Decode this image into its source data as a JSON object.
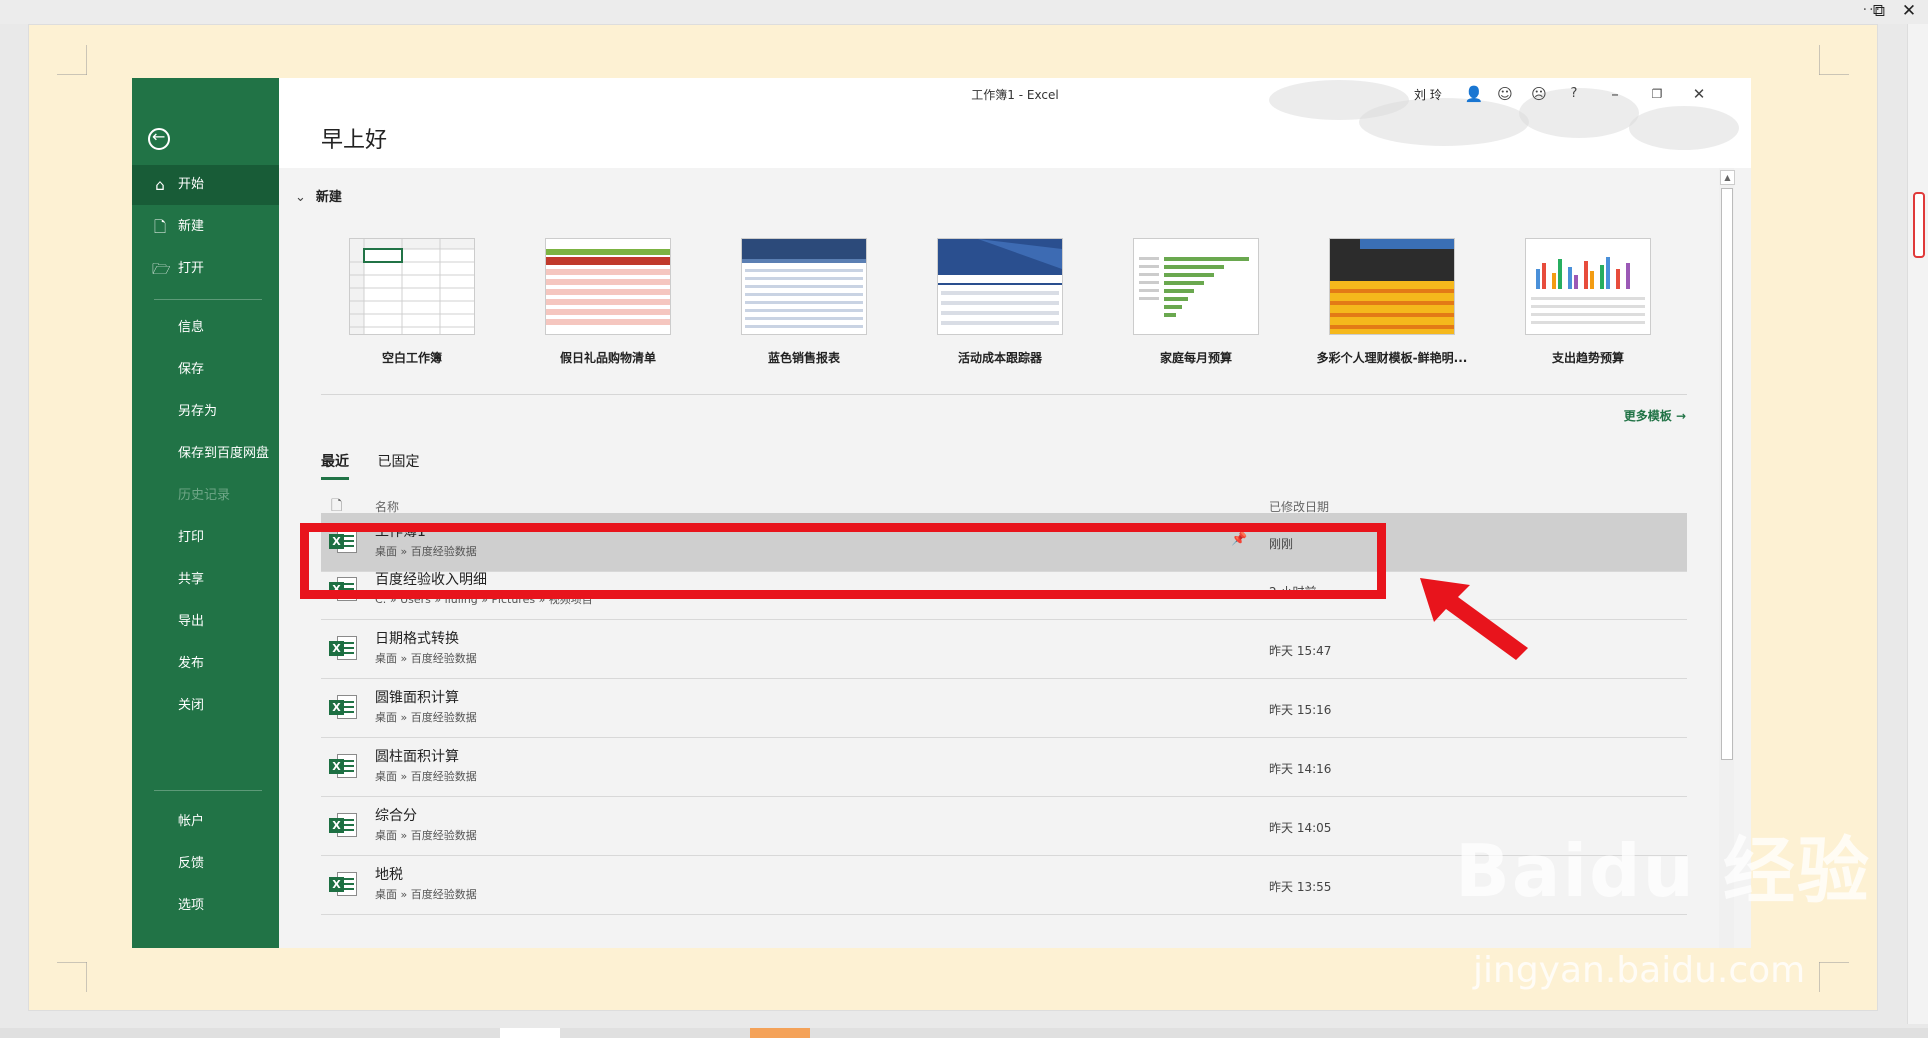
{
  "window": {
    "title": "工作簿1  -  Excel",
    "user": "刘 玲"
  },
  "outer": {
    "more": "···"
  },
  "sidebar": {
    "items": [
      {
        "label": "开始",
        "icon": "home-icon"
      },
      {
        "label": "新建",
        "icon": "new-file-icon"
      },
      {
        "label": "打开",
        "icon": "folder-open-icon"
      },
      {
        "label": "信息"
      },
      {
        "label": "保存"
      },
      {
        "label": "另存为"
      },
      {
        "label": "保存到百度网盘"
      },
      {
        "label": "历史记录"
      },
      {
        "label": "打印"
      },
      {
        "label": "共享"
      },
      {
        "label": "导出"
      },
      {
        "label": "发布"
      },
      {
        "label": "关闭"
      },
      {
        "label": "帐户"
      },
      {
        "label": "反馈"
      },
      {
        "label": "选项"
      }
    ]
  },
  "main": {
    "greeting": "早上好",
    "new_section": "新建",
    "templates": [
      {
        "name": "空白工作簿"
      },
      {
        "name": "假日礼品购物清单"
      },
      {
        "name": "蓝色销售报表"
      },
      {
        "name": "活动成本跟踪器"
      },
      {
        "name": "家庭每月预算"
      },
      {
        "name": "多彩个人理财模板-鲜艳明..."
      },
      {
        "name": "支出趋势预算"
      }
    ],
    "more_templates": "更多模板",
    "tabs": [
      "最近",
      "已固定"
    ],
    "columns": {
      "name": "名称",
      "date": "已修改日期"
    },
    "files": [
      {
        "name": "工作簿1",
        "path": "桌面 » 百度经验数据",
        "date": "刚刚"
      },
      {
        "name": "百度经验收入明细",
        "path": "C: » Users » liuling » Pictures » 视频项目",
        "date": "2 小时前"
      },
      {
        "name": "日期格式转换",
        "path": "桌面 » 百度经验数据",
        "date": "昨天 15:47"
      },
      {
        "name": "圆锥面积计算",
        "path": "桌面 » 百度经验数据",
        "date": "昨天 15:16"
      },
      {
        "name": "圆柱面积计算",
        "path": "桌面 » 百度经验数据",
        "date": "昨天 14:16"
      },
      {
        "name": "综合分",
        "path": "桌面 » 百度经验数据",
        "date": "昨天 14:05"
      },
      {
        "name": "地税",
        "path": "桌面 » 百度经验数据",
        "date": "昨天 13:55"
      }
    ]
  },
  "watermark": {
    "brand": "Baidu 经验",
    "url": "jingyan.baidu.com"
  },
  "colors": {
    "accent": "#217346",
    "highlight": "#e8141c"
  }
}
